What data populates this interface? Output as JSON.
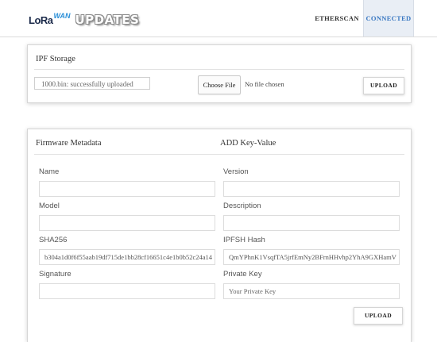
{
  "header": {
    "logo_lora": "LoRa",
    "logo_wan": "WAN",
    "title": "UPDATES",
    "nav": [
      {
        "label": "ETHERSCAN"
      },
      {
        "label": "CONNECTED"
      }
    ],
    "accent_color": "#3a78c2"
  },
  "ipfs_card": {
    "title": "IPF Storage",
    "status_text": "1000.bin: successfully uploaded",
    "choose_file_label": "Choose File",
    "no_file_text": "No file chosen",
    "upload_label": "UPLOAD"
  },
  "metadata_card": {
    "title_left": "Firmware Metadata",
    "title_right": "ADD Key-Value",
    "fields": {
      "name": {
        "label": "Name",
        "value": ""
      },
      "version": {
        "label": "Version",
        "value": ""
      },
      "model": {
        "label": "Model",
        "value": ""
      },
      "description": {
        "label": "Description",
        "value": ""
      },
      "sha256": {
        "label": "SHA256",
        "value": "b304a1d0f6f55aab19df715de1bb28cf16651c4e1b0b52c24a14"
      },
      "ipfsh": {
        "label": "IPFSH Hash",
        "value": "QmYPhnK1VsqfTA5jrfEmNy2BFrnHHvhp2YhA9GXHamV"
      },
      "signature": {
        "label": "Signature",
        "value": ""
      },
      "private_key": {
        "label": "Private Key",
        "value": "",
        "placeholder": "Your Private Key"
      }
    },
    "upload_label": "UPLOAD"
  }
}
